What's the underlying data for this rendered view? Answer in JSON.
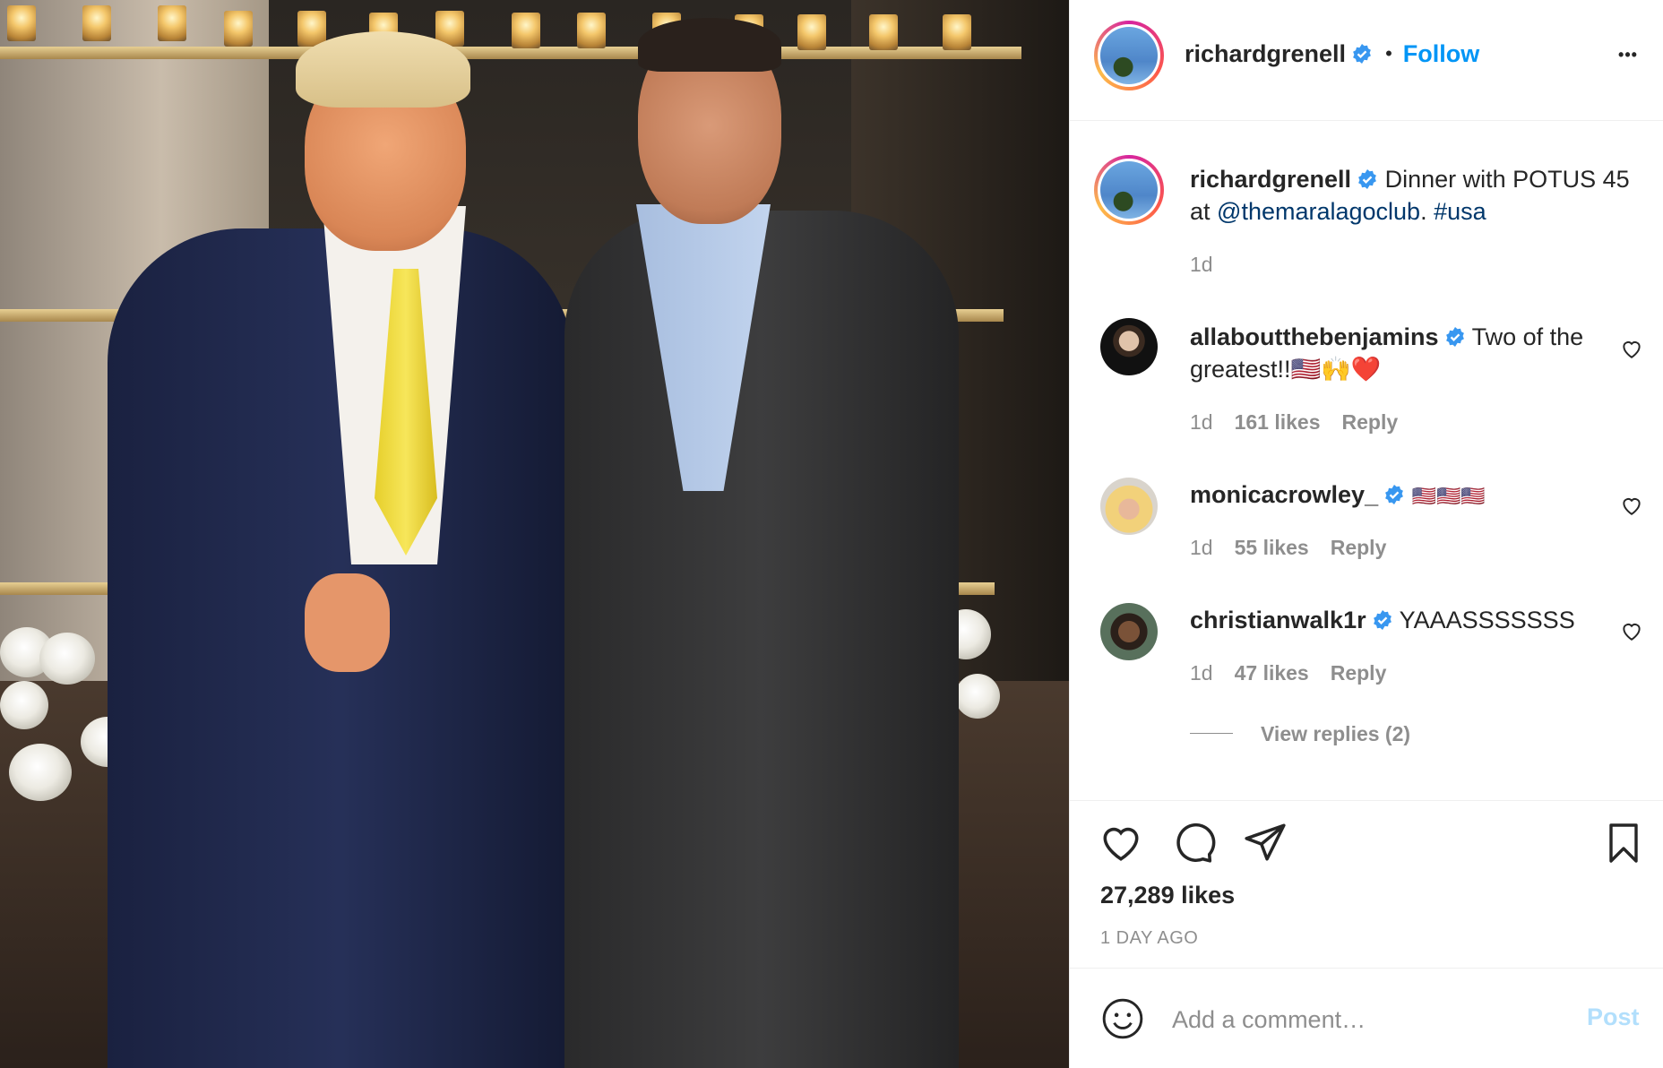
{
  "post": {
    "author": "richardgrenell",
    "follow_label": "Follow",
    "separator": "•",
    "more_label": "•••",
    "caption_prefix": "Dinner with POTUS 45 at ",
    "caption_mention": "@themaralagoclub",
    "caption_mid": ". ",
    "caption_hashtag": "#usa",
    "caption_time": "1d",
    "likes": "27,289 likes",
    "posted_ago": "1 DAY AGO"
  },
  "comments": [
    {
      "username": "allaboutthebenjamins",
      "text_line1": "Two of",
      "text_line2": "the greatest!!🇺🇸🙌❤️",
      "time": "1d",
      "likes": "161 likes",
      "reply": "Reply"
    },
    {
      "username": "monicacrowley_",
      "text_line1": "🇺🇸🇺🇸🇺🇸",
      "time": "1d",
      "likes": "55 likes",
      "reply": "Reply"
    },
    {
      "username": "christianwalk1r",
      "text_line1": "YAAASSSSSSS",
      "time": "1d",
      "likes": "47 likes",
      "reply": "Reply",
      "view_replies": "View replies (2)"
    }
  ],
  "comment_box": {
    "placeholder": "Add a comment…",
    "post_label": "Post"
  },
  "colors": {
    "accent": "#0095f6",
    "verified": "#3897f0",
    "meta": "#8e8e8e",
    "post_disabled": "#b2dffc"
  },
  "icons": [
    "verified-badge-icon",
    "more-options-icon",
    "like-heart-icon",
    "comment-bubble-icon",
    "share-paper-plane-icon",
    "save-bookmark-icon",
    "emoji-smiley-icon",
    "small-heart-icon"
  ]
}
